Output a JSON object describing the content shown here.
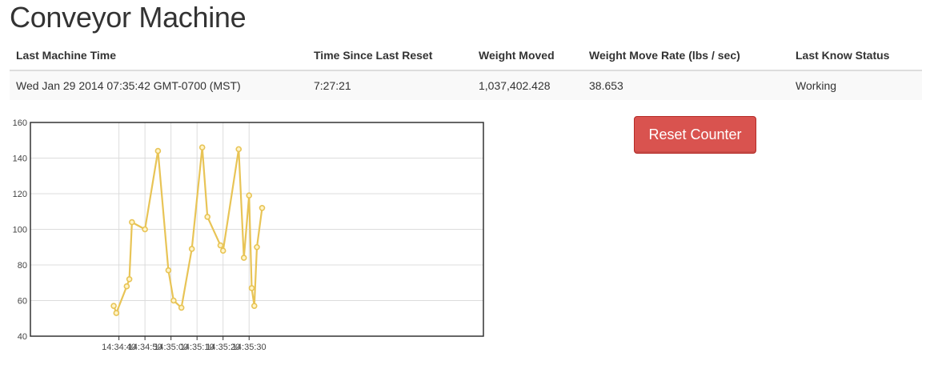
{
  "page": {
    "title": "Conveyor Machine"
  },
  "table": {
    "headers": [
      "Last Machine Time",
      "Time Since Last Reset",
      "Weight Moved",
      "Weight Move Rate (lbs / sec)",
      "Last Know Status"
    ],
    "row": [
      "Wed Jan 29 2014 07:35:42 GMT-0700 (MST)",
      "7:27:21",
      "1,037,402.428",
      "38.653",
      "Working"
    ]
  },
  "controls": {
    "reset_label": "Reset Counter"
  },
  "colors": {
    "line": "#e8c456",
    "button": "#d9534f"
  },
  "chart_data": {
    "type": "line",
    "ylim": [
      40,
      160
    ],
    "yticks": [
      40,
      60,
      80,
      100,
      120,
      140,
      160
    ],
    "xticks": [
      "14:34:40",
      "14:34:50",
      "14:35:00",
      "14:35:10",
      "14:35:20",
      "14:35:30"
    ],
    "xlim_seconds": [
      34.1,
      37.0
    ],
    "grid": true,
    "series": [
      {
        "x": [
          "14:34:38",
          "14:34:39",
          "14:34:43",
          "14:34:44",
          "14:34:45",
          "14:34:50",
          "14:34:55",
          "14:34:59",
          "14:35:01",
          "14:35:04",
          "14:35:08",
          "14:35:12",
          "14:35:14",
          "14:35:19",
          "14:35:20",
          "14:35:26",
          "14:35:28",
          "14:35:30",
          "14:35:31",
          "14:35:32",
          "14:35:33",
          "14:35:35"
        ],
        "values": [
          57,
          53,
          68,
          72,
          104,
          100,
          144,
          77,
          60,
          56,
          89,
          146,
          107,
          91,
          88,
          145,
          84,
          119,
          67,
          57,
          90,
          112
        ]
      }
    ]
  }
}
